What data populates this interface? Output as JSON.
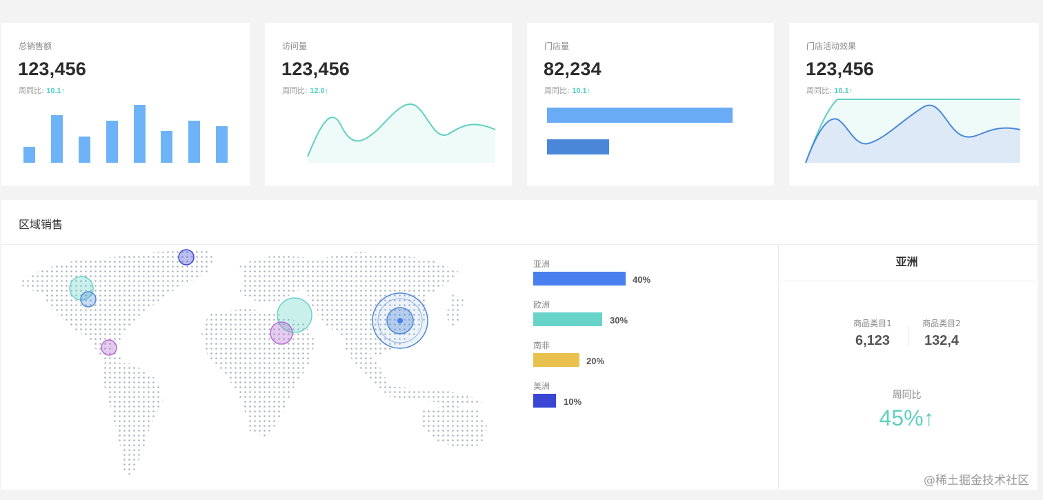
{
  "cards": [
    {
      "title": "总销售额",
      "value": "123,456",
      "compare_label": "周同比:",
      "compare_value": "10.1↑"
    },
    {
      "title": "访问量",
      "value": "123,456",
      "compare_label": "周同比:",
      "compare_value": "12.0↑"
    },
    {
      "title": "门店量",
      "value": "82,234",
      "compare_label": "周同比:",
      "compare_value": "10.1↑"
    },
    {
      "title": "门店活动效果",
      "value": "123,456",
      "compare_label": "周同比:",
      "compare_value": "10.1↑"
    }
  ],
  "region": {
    "title": "区域销售",
    "legend": [
      {
        "name": "亚洲",
        "percent": "40%",
        "value": 40,
        "color": "#4a80ed"
      },
      {
        "name": "欧洲",
        "percent": "30%",
        "value": 30,
        "color": "#68d3c8"
      },
      {
        "name": "南非",
        "percent": "20%",
        "value": 20,
        "color": "#e8c14f"
      },
      {
        "name": "美洲",
        "percent": "10%",
        "value": 10,
        "color": "#3a46d4"
      }
    ],
    "detail": {
      "title": "亚洲",
      "category1_label": "商品类目1",
      "category1_value": "6,123",
      "category2_label": "商品类目2",
      "category2_value": "132,4",
      "wow_label": "周同比",
      "wow_value": "45%↑"
    }
  },
  "colors": {
    "accent": "#4ecdc4",
    "bar": "#6eb3f7",
    "bar_dark": "#4a87d8"
  },
  "watermark": "@稀土掘金技术社区"
}
